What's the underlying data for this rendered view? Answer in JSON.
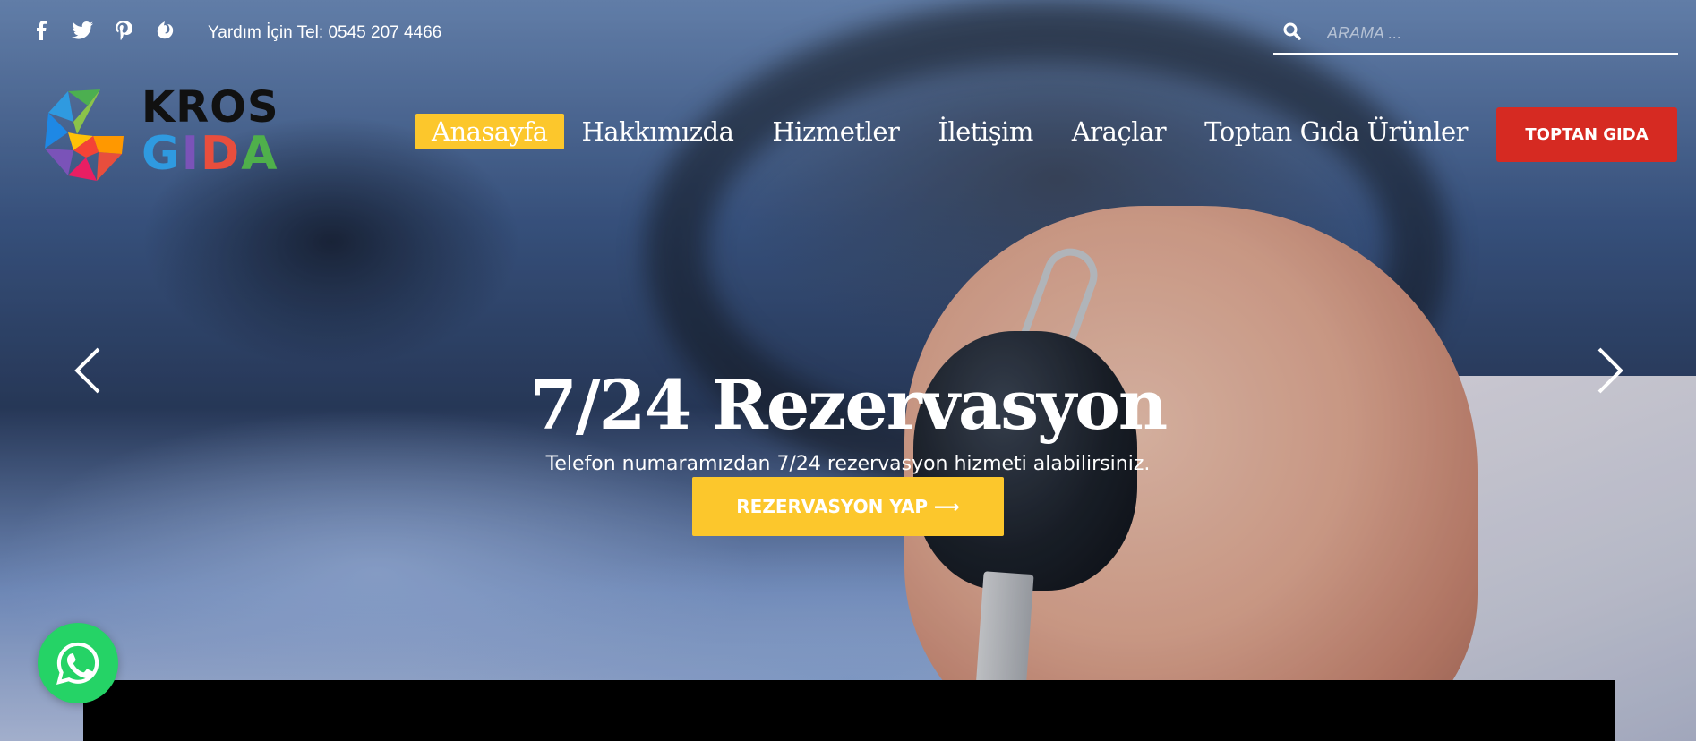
{
  "topbar": {
    "social_icons": [
      "facebook-icon",
      "twitter-icon",
      "pinterest-icon",
      "vine-icon"
    ],
    "help_text": "Yardım İçin Tel: 0545 207 4466",
    "search": {
      "placeholder": "ARAMA ...",
      "value": "",
      "icon": "search-icon"
    }
  },
  "header": {
    "logo": {
      "line1": "KROS",
      "line2": "GIDA"
    },
    "nav": [
      {
        "label": "Anasayfa",
        "active": true
      },
      {
        "label": "Hakkımızda",
        "active": false
      },
      {
        "label": "Hizmetler",
        "active": false
      },
      {
        "label": "İletişim",
        "active": false
      },
      {
        "label": "Araçlar",
        "active": false
      },
      {
        "label": "Toptan Gıda Ürünler",
        "active": false
      }
    ],
    "cta_label": "TOPTAN GIDA"
  },
  "slider": {
    "title": "7/24 Rezervasyon",
    "subtitle": "Telefon numaramızdan 7/24 rezervasyon hizmeti alabilirsiniz.",
    "button_label": "REZERVASYON YAP ⟶",
    "prev_icon": "chevron-left-icon",
    "next_icon": "chevron-right-icon"
  },
  "floating": {
    "whatsapp_icon": "whatsapp-icon"
  },
  "colors": {
    "accent_yellow": "#fcc72c",
    "accent_red": "#d62a22",
    "whatsapp_green": "#25d366"
  }
}
